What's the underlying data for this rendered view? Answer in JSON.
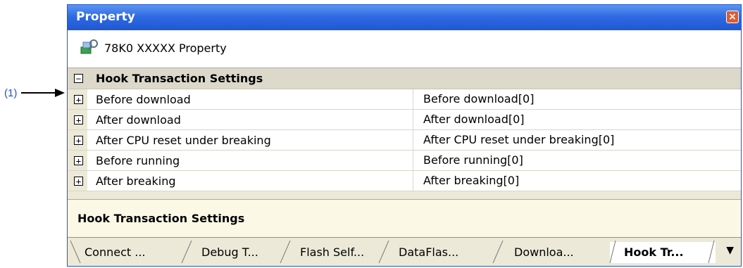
{
  "callout": {
    "label": "(1)"
  },
  "window": {
    "title": "Property"
  },
  "header": {
    "text": "78K0 XXXXX Property"
  },
  "category": {
    "label": "Hook Transaction Settings",
    "expander": "⊟"
  },
  "rows": [
    {
      "name": "Before download",
      "value": "Before download[0]"
    },
    {
      "name": "After download",
      "value": "After download[0]"
    },
    {
      "name": "After CPU reset under breaking",
      "value": "After CPU reset under breaking[0]"
    },
    {
      "name": "Before running",
      "value": "Before running[0]"
    },
    {
      "name": "After breaking",
      "value": "After breaking[0]"
    }
  ],
  "description": {
    "text": "Hook Transaction Settings"
  },
  "tabs": [
    {
      "label": "Connect ..."
    },
    {
      "label": "Debug T..."
    },
    {
      "label": "Flash Self..."
    },
    {
      "label": "DataFlas..."
    },
    {
      "label": "Downloa..."
    },
    {
      "label": "Hook Tr..."
    }
  ],
  "tab_menu_icon": "▼",
  "colors": {
    "titlebar": "#2f6ae2",
    "callout": "#1f4fd6",
    "desc_bg": "#fbf9e6"
  }
}
